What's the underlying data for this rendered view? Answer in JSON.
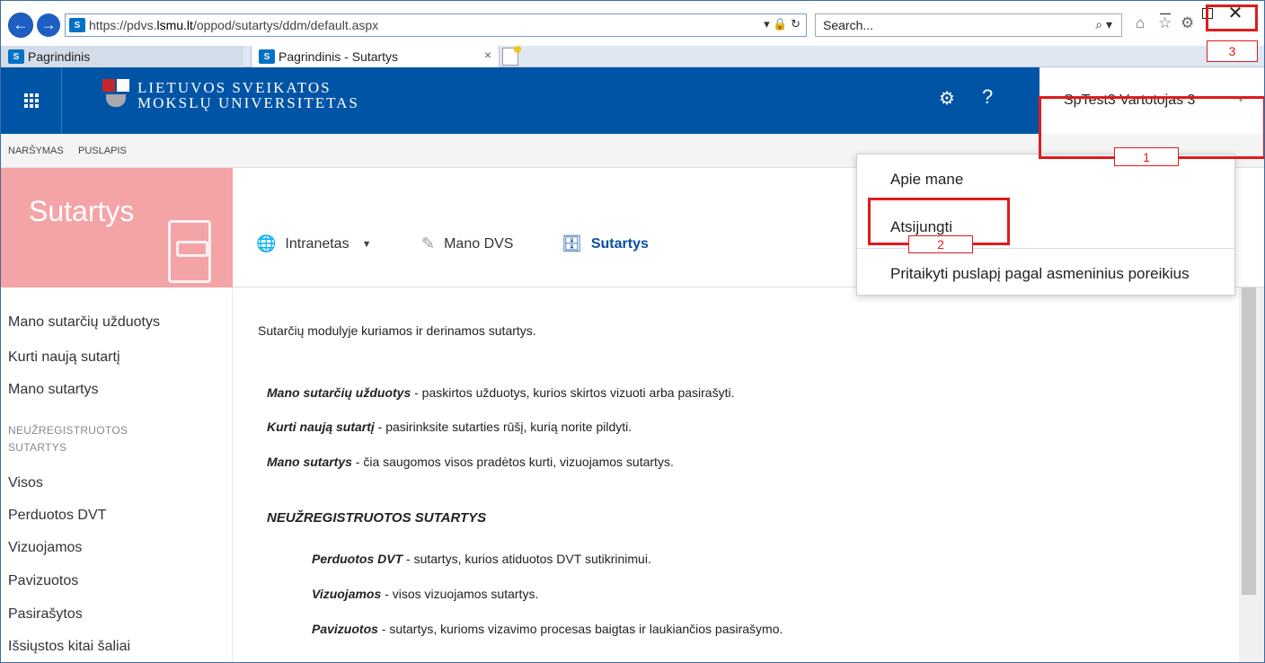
{
  "browser": {
    "url_prefix": "https://pdvs.",
    "url_domain": "lsmu.lt",
    "url_path": "/oppod/sutartys/ddm/default.aspx",
    "addr_tools": "▾ 🔒 ↻",
    "search_placeholder": "Search...",
    "search_icon": "⌕ ▾",
    "sp_icon_text": "S",
    "tabs": [
      {
        "label": "Pagrindinis"
      },
      {
        "label": "Pagrindinis - Sutartys",
        "close": "×"
      }
    ],
    "window_close": "✕"
  },
  "suite": {
    "university_line1": "LIETUVOS SVEIKATOS",
    "university_line2": "MOKSLŲ UNIVERSITETAS",
    "user_name": "SpTest3 Vartotojas 3",
    "settings_icon": "⚙",
    "help_icon": "?",
    "caret": "▼"
  },
  "ribbon": {
    "browse": "NARŠYMAS",
    "page": "PUSLAPIS"
  },
  "site": {
    "title": "Sutartys"
  },
  "topnav": {
    "intranet": "Intranetas",
    "intranet_caret": "▼",
    "my_dvs": "Mano DVS",
    "contracts": "Sutartys",
    "globe_icon": "🌐",
    "tools_icon": "✎",
    "inbox_icon": "🗄"
  },
  "leftnav": {
    "items_top": [
      "Mano sutarčių užduotys",
      "Kurti naują sutartį",
      "Mano sutartys"
    ],
    "heading_line1": "NEUŽREGISTRUOTOS",
    "heading_line2": "SUTARTYS",
    "items_bottom": [
      "Visos",
      "Perduotos DVT",
      "Vizuojamos",
      "Pavizuotos",
      "Pasirašytos",
      "Išsiųstos kitai šaliai"
    ]
  },
  "content": {
    "intro": "Sutarčių modulyje kuriamos ir derinamos sutartys.",
    "lines": [
      {
        "term": "Mano sutarčių užduotys",
        "desc": " - paskirtos užduotys, kurios skirtos vizuoti arba pasirašyti."
      },
      {
        "term": "Kurti naują sutartį",
        "desc": " - pasirinksite sutarties rūšį, kurią norite pildyti."
      },
      {
        "term": "Mano sutartys",
        "desc": " - čia saugomos visos pradėtos kurti, vizuojamos sutartys."
      }
    ],
    "section_heading": "NEUŽREGISTRUOTOS SUTARTYS",
    "sublines": [
      {
        "term": "Perduotos DVT",
        "desc": " - sutartys, kurios atiduotos DVT sutikrinimui."
      },
      {
        "term": "Vizuojamos",
        "desc": " - visos vizuojamos sutartys."
      },
      {
        "term": "Pavizuotos",
        "desc": " - sutartys, kurioms vizavimo procesas baigtas ir laukiančios pasirašymo."
      }
    ]
  },
  "user_menu": {
    "about": "Apie mane",
    "sign_out": "Atsijungti",
    "personalize": "Pritaikyti puslapį pagal asmeninius poreikius"
  },
  "annotations": {
    "step1": "1",
    "step2": "2",
    "step3": "3"
  }
}
